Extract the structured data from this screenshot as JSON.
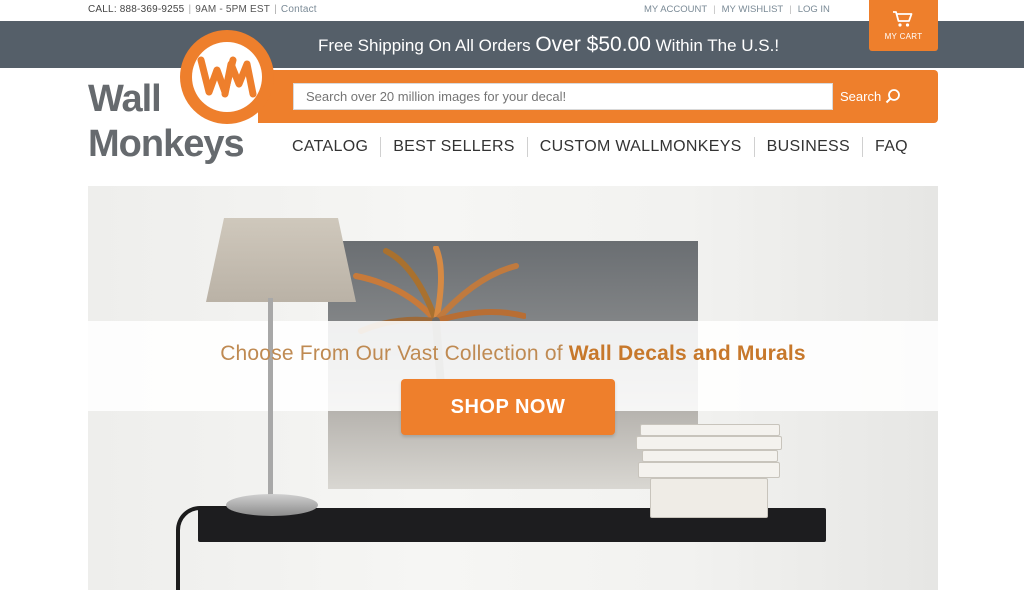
{
  "topbar": {
    "call": "CALL: 888-369-9255",
    "hours": "9AM - 5PM EST",
    "contact": "Contact",
    "account": "MY ACCOUNT",
    "wishlist": "MY WISHLIST",
    "login": "LOG IN"
  },
  "cart": {
    "label": "MY CART",
    "icon": "cart-icon"
  },
  "shipping": {
    "lead": "Free Shipping On All Orders ",
    "amount": "Over $50.00",
    "tail": " Within The U.S.!"
  },
  "logo": {
    "line1": "Wall",
    "line2": "Monkeys"
  },
  "search": {
    "placeholder": "Search over 20 million images for your decal!",
    "button": "Search",
    "icon": "search-icon"
  },
  "nav": {
    "items": [
      "CATALOG",
      "BEST SELLERS",
      "CUSTOM WALLMONKEYS",
      "BUSINESS",
      "FAQ"
    ]
  },
  "hero": {
    "headline_lead": "Choose From Our Vast Collection of ",
    "headline_strong": "Wall Decals and Murals",
    "cta": "SHOP NOW"
  },
  "colors": {
    "accent": "#ee7f2c",
    "banner": "#555f69",
    "logo_gray": "#666a6e"
  }
}
